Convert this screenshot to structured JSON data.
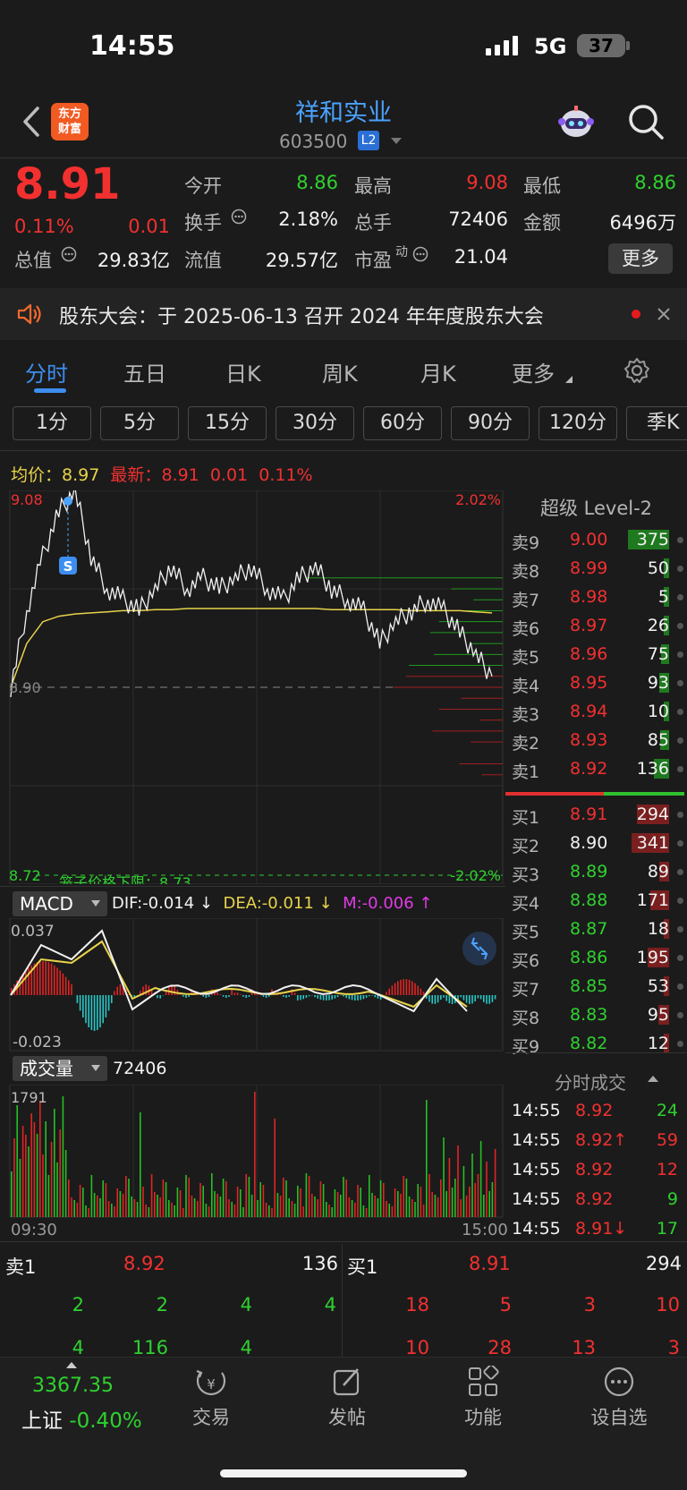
{
  "status_bar": {
    "time": "14:55",
    "network": "5G",
    "battery": "37"
  },
  "nav": {
    "logo_line1": "东方",
    "logo_line2": "财富",
    "stock_name": "祥和实业",
    "stock_code": "603500",
    "level_badge": "L2"
  },
  "quote": {
    "price": "8.91",
    "change_pct": "0.11%",
    "change": "0.01",
    "open_label": "今开",
    "open": "8.86",
    "high_label": "最高",
    "high": "9.08",
    "low_label": "最低",
    "low": "8.86",
    "turnover_label": "换手",
    "turnover": "2.18%",
    "volume_label": "总手",
    "volume": "72406",
    "amount_label": "金额",
    "amount": "6496万",
    "mktcap_label": "总值",
    "mktcap": "29.83亿",
    "float_label": "流值",
    "float_cap": "29.57亿",
    "pe_label": "市盈",
    "pe_sup": "动",
    "pe": "21.04",
    "more": "更多"
  },
  "notice": {
    "text": "股东大会：于 2025-06-13 召开 2024 年年度股东大会"
  },
  "tabs": [
    "分时",
    "五日",
    "日K",
    "周K",
    "月K",
    "更多"
  ],
  "periods": [
    "1分",
    "5分",
    "15分",
    "30分",
    "60分",
    "90分",
    "120分",
    "季K"
  ],
  "chart_legend": {
    "avg_label": "均价：",
    "avg": "8.97",
    "latest_label": "最新：",
    "latest": "8.91",
    "latest_change": "0.01",
    "latest_pct": "0.11%"
  },
  "intraday": {
    "y_top": "9.08",
    "y_mid": "8.90",
    "y_bottom": "8.72",
    "pct_top": "2.02%",
    "pct_bottom": "-2.02%",
    "limit_text": "笼子价格下限：8.73",
    "marker": "S"
  },
  "chart_data": {
    "type": "line",
    "title": "",
    "xlabel": "",
    "ylabel": "",
    "x_range": [
      "09:30",
      "15:00"
    ],
    "ylim": [
      8.72,
      9.08
    ],
    "series": [
      {
        "values": [
          8.9,
          8.97,
          9.02,
          9.06,
          9.08,
          9.02,
          8.99,
          8.98,
          8.97,
          8.99,
          9.01,
          8.99,
          9.0,
          8.99,
          9.0,
          9.01,
          8.99,
          8.98,
          9.0,
          9.01,
          8.99,
          8.98,
          8.97,
          8.94,
          8.96,
          8.97,
          8.98,
          8.97,
          8.95,
          8.93,
          8.91
        ]
      },
      {
        "values": [
          8.9,
          8.94,
          8.96,
          8.965,
          8.967,
          8.968,
          8.969,
          8.97,
          8.97,
          8.971,
          8.971,
          8.972,
          8.972,
          8.972,
          8.972,
          8.972,
          8.972,
          8.972,
          8.972,
          8.972,
          8.971,
          8.971,
          8.971,
          8.971,
          8.971,
          8.97,
          8.97,
          8.97,
          8.97,
          8.969,
          8.968
        ]
      }
    ]
  },
  "macd": {
    "label": "MACD",
    "dif": "DIF:-0.014 ↓",
    "dea": "DEA:-0.011 ↓",
    "m": "M:-0.006 ↑",
    "top": "0.037",
    "bottom": "-0.023"
  },
  "volume_panel": {
    "label": "成交量",
    "value": "72406",
    "top": "1791",
    "start": "09:30",
    "end": "15:00"
  },
  "orderbook": {
    "title": "超级 Level-2",
    "asks": [
      {
        "label": "卖9",
        "price": "9.00",
        "vol": "375"
      },
      {
        "label": "卖8",
        "price": "8.99",
        "vol": "50"
      },
      {
        "label": "卖7",
        "price": "8.98",
        "vol": "5"
      },
      {
        "label": "卖6",
        "price": "8.97",
        "vol": "26"
      },
      {
        "label": "卖5",
        "price": "8.96",
        "vol": "75"
      },
      {
        "label": "卖4",
        "price": "8.95",
        "vol": "93"
      },
      {
        "label": "卖3",
        "price": "8.94",
        "vol": "10"
      },
      {
        "label": "卖2",
        "price": "8.93",
        "vol": "85"
      },
      {
        "label": "卖1",
        "price": "8.92",
        "vol": "136"
      }
    ],
    "bids": [
      {
        "label": "买1",
        "price": "8.91",
        "vol": "294"
      },
      {
        "label": "买2",
        "price": "8.90",
        "vol": "341"
      },
      {
        "label": "买3",
        "price": "8.89",
        "vol": "89"
      },
      {
        "label": "买4",
        "price": "8.88",
        "vol": "171"
      },
      {
        "label": "买5",
        "price": "8.87",
        "vol": "18"
      },
      {
        "label": "买6",
        "price": "8.86",
        "vol": "195"
      },
      {
        "label": "买7",
        "price": "8.85",
        "vol": "53"
      },
      {
        "label": "买8",
        "price": "8.83",
        "vol": "95"
      },
      {
        "label": "买9",
        "price": "8.82",
        "vol": "12"
      }
    ]
  },
  "ticks": {
    "title": "分时成交",
    "rows": [
      {
        "time": "14:55",
        "price": "8.92",
        "vol": "24"
      },
      {
        "time": "14:55",
        "price": "8.92↑",
        "vol": "59"
      },
      {
        "time": "14:55",
        "price": "8.92",
        "vol": "12"
      },
      {
        "time": "14:55",
        "price": "8.92",
        "vol": "9"
      },
      {
        "time": "14:55",
        "price": "8.91↓",
        "vol": "17"
      }
    ]
  },
  "book_bottom": {
    "ask_label": "卖1",
    "ask_price": "8.92",
    "ask_vol": "136",
    "bid_label": "买1",
    "bid_price": "8.91",
    "bid_vol": "294",
    "ask_queue": [
      "2",
      "2",
      "4",
      "4",
      "4",
      "116",
      "4"
    ],
    "bid_queue": [
      "18",
      "5",
      "3",
      "10",
      "10",
      "28",
      "13",
      "3"
    ]
  },
  "bottom_nav": {
    "index_value": "3367.35",
    "index_name": "上证",
    "index_pct": "-0.40%",
    "items": [
      "交易",
      "发帖",
      "功能",
      "设自选"
    ]
  },
  "colors": {
    "up": "#f23030",
    "down": "#2fd12f",
    "accent": "#3d8ef0",
    "price_line": "#ffffff",
    "avg_line": "#e8d34a"
  }
}
